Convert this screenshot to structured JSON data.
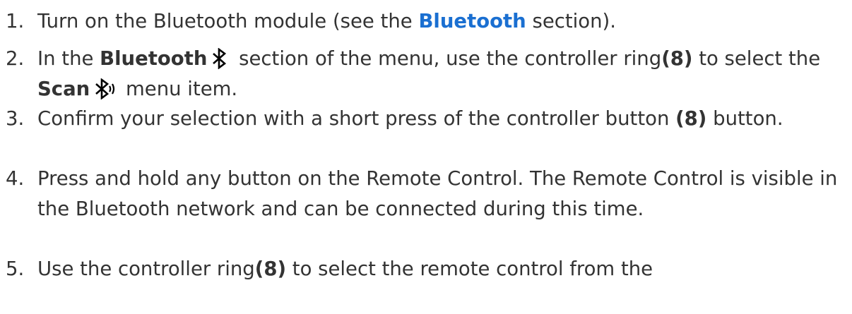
{
  "steps": [
    {
      "number": "1.",
      "parts": [
        "Turn on the Bluetooth module (see the ",
        "Bluetooth",
        " section)."
      ]
    },
    {
      "number": "2.",
      "parts": [
        "In the ",
        "Bluetooth",
        " section of the menu, use the controller ring",
        "(8)",
        " to select the ",
        "Scan",
        " menu item."
      ]
    },
    {
      "number": "3.",
      "parts": [
        "Confirm your selection with a short press of the controller button ",
        "(8)",
        " button."
      ]
    },
    {
      "number": "4.",
      "parts": [
        "Press and hold any button on the Remote Control. The Remote Control is visible in the Bluetooth network and can be connected during this time."
      ]
    },
    {
      "number": "5.",
      "parts": [
        "Use the controller ring",
        "(8)",
        " to select the remote control from the"
      ]
    }
  ],
  "icons": {
    "bluetooth": "bluetooth-icon",
    "bluetooth_scan": "bluetooth-scan-icon"
  },
  "colors": {
    "text": "#333333",
    "link": "#1a6fd1",
    "icon": "#000000"
  }
}
